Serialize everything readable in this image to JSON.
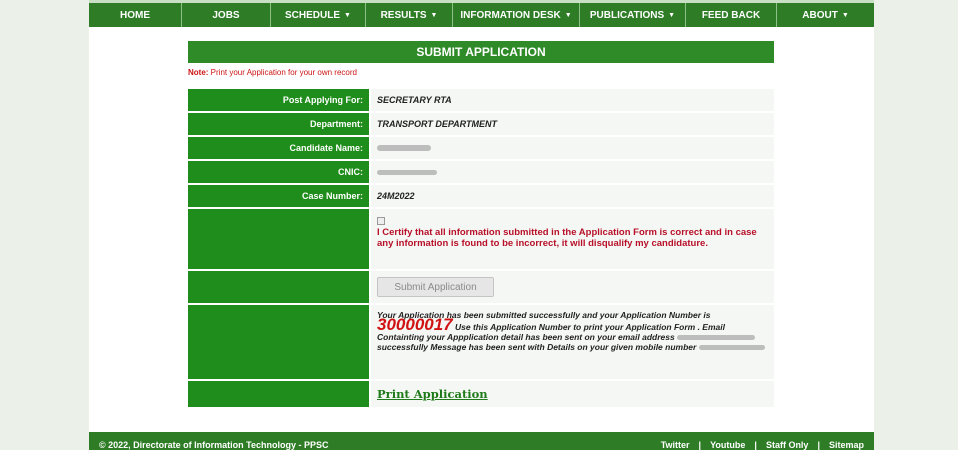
{
  "nav": {
    "items": [
      {
        "label": "HOME",
        "caret": false
      },
      {
        "label": "JOBS",
        "caret": false
      },
      {
        "label": "SCHEDULE",
        "caret": true
      },
      {
        "label": "RESULTS",
        "caret": true
      },
      {
        "label": "INFORMATION DESK",
        "caret": true
      },
      {
        "label": "PUBLICATIONS",
        "caret": true
      },
      {
        "label": "FEED BACK",
        "caret": false
      },
      {
        "label": "ABOUT",
        "caret": true
      }
    ]
  },
  "title": "SUBMIT APPLICATION",
  "note": {
    "prefix": "Note:",
    "text": " Print your Application for your own record"
  },
  "form": {
    "post_label": "Post Applying For:",
    "post_value": "SECRETARY RTA",
    "dept_label": "Department:",
    "dept_value": "TRANSPORT DEPARTMENT",
    "name_label": "Candidate Name:",
    "cnic_label": "CNIC:",
    "case_label": "Case Number:",
    "case_value": "24M2022",
    "certify_text": "I Certify that all information submitted in the Application Form is correct and in case any information is found to be incorrect, it will disqualify my candidature.",
    "submit_label": "Submit Application",
    "msg_line1": "Your Application has been submitted successfully and your Application Number is",
    "app_number": "30000017",
    "msg_line2": " Use this Application Number to print your Application Form . Email Containting your Appplication detail has been sent on your email address",
    "msg_line3": "successfully Message has been sent with Details on your given mobile number",
    "print_label": "Print Application"
  },
  "footer": {
    "copyright": "© 2022, Directorate of Information Technology - PPSC",
    "links": [
      "Twitter",
      "Youtube",
      "Staff Only",
      "Sitemap"
    ]
  },
  "colors": {
    "nav_green": "#2e7d26",
    "label_green": "#1f8d1b",
    "accent_red": "#d11212"
  }
}
